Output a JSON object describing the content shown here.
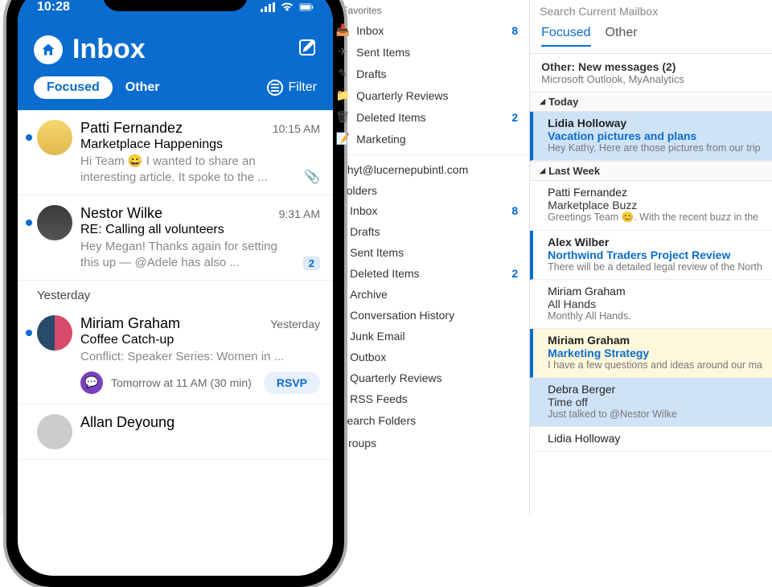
{
  "phone": {
    "status_time": "10:28",
    "title": "Inbox",
    "tab_focused": "Focused",
    "tab_other": "Other",
    "filter_label": "Filter",
    "section_yesterday": "Yesterday",
    "messages": [
      {
        "sender": "Patti Fernandez",
        "time": "10:15 AM",
        "subject": "Marketplace Happenings",
        "preview": "Hi Team 😀 I wanted to share an interesting article. It spoke to the ...",
        "has_attachment": true,
        "unread": true
      },
      {
        "sender": "Nestor Wilke",
        "time": "9:31 AM",
        "subject": "RE: Calling all volunteers",
        "preview": "Hey Megan! Thanks again for setting this up — @Adele has also ...",
        "count": "2",
        "unread": true
      },
      {
        "sender": "Miriam Graham",
        "time": "Yesterday",
        "subject": "Coffee Catch-up",
        "preview": "Conflict: Speaker Series: Women in ...",
        "event_text": "Tomorrow at 11 AM (30 min)",
        "rsvp_label": "RSVP",
        "unread": true
      },
      {
        "sender": "Allan Deyoung"
      }
    ]
  },
  "desktop": {
    "favorites_label": "Favorites",
    "favorites": [
      {
        "icon": "inbox",
        "label": "Inbox",
        "count": "8"
      },
      {
        "icon": "sent",
        "label": "Sent Items"
      },
      {
        "icon": "drafts",
        "label": "Drafts"
      },
      {
        "icon": "folder",
        "label": "Quarterly Reviews"
      },
      {
        "icon": "trash",
        "label": "Deleted Items",
        "count": "2"
      },
      {
        "icon": "note",
        "label": "Marketing"
      }
    ],
    "account_email": "kathyt@lucernepubintl.com",
    "folders_header": "Folders",
    "folders": [
      {
        "label": "Inbox",
        "count": "8"
      },
      {
        "label": "Drafts"
      },
      {
        "label": "Sent Items"
      },
      {
        "label": "Deleted Items",
        "count": "2"
      },
      {
        "label": "Archive"
      },
      {
        "label": "Conversation History"
      },
      {
        "label": "Junk Email"
      },
      {
        "label": "Outbox"
      },
      {
        "label": "Quarterly Reviews"
      },
      {
        "label": "RSS Feeds"
      }
    ],
    "search_folders_label": "Search Folders",
    "groups_label": "Groups",
    "search_placeholder": "Search Current Mailbox",
    "tab_focused": "Focused",
    "tab_other": "Other",
    "other_summary_title": "Other: New messages (2)",
    "other_summary_sub": "Microsoft Outlook, MyAnalytics",
    "group_today": "Today",
    "group_lastweek": "Last Week",
    "emails_today": [
      {
        "from": "Lidia Holloway",
        "subject": "Vacation pictures and plans",
        "preview": "Hey Kathy,  Here are those pictures from our trip",
        "unread": true,
        "selected": true
      }
    ],
    "emails_lastweek": [
      {
        "from": "Patti Fernandez",
        "subject": "Marketplace Buzz",
        "preview": "Greetings Team 😊.  With the recent buzz in the"
      },
      {
        "from": "Alex Wilber",
        "subject": "Northwind Traders Project Review",
        "preview": "There will be a detailed legal review of the North",
        "unread": true
      },
      {
        "from": "Miriam Graham",
        "subject": "All Hands",
        "preview": "Monthly All Hands."
      },
      {
        "from": "Miriam Graham",
        "subject": "Marketing Strategy",
        "preview": "I have a few questions and ideas around our ma",
        "unread": true,
        "flagged": true
      },
      {
        "from": "Debra Berger",
        "subject": "Time off",
        "preview": "Just talked to @Nestor Wilke <mailto:NestorW@",
        "selected": true
      },
      {
        "from": "Lidia Holloway",
        "subject": "",
        "preview": ""
      }
    ]
  }
}
